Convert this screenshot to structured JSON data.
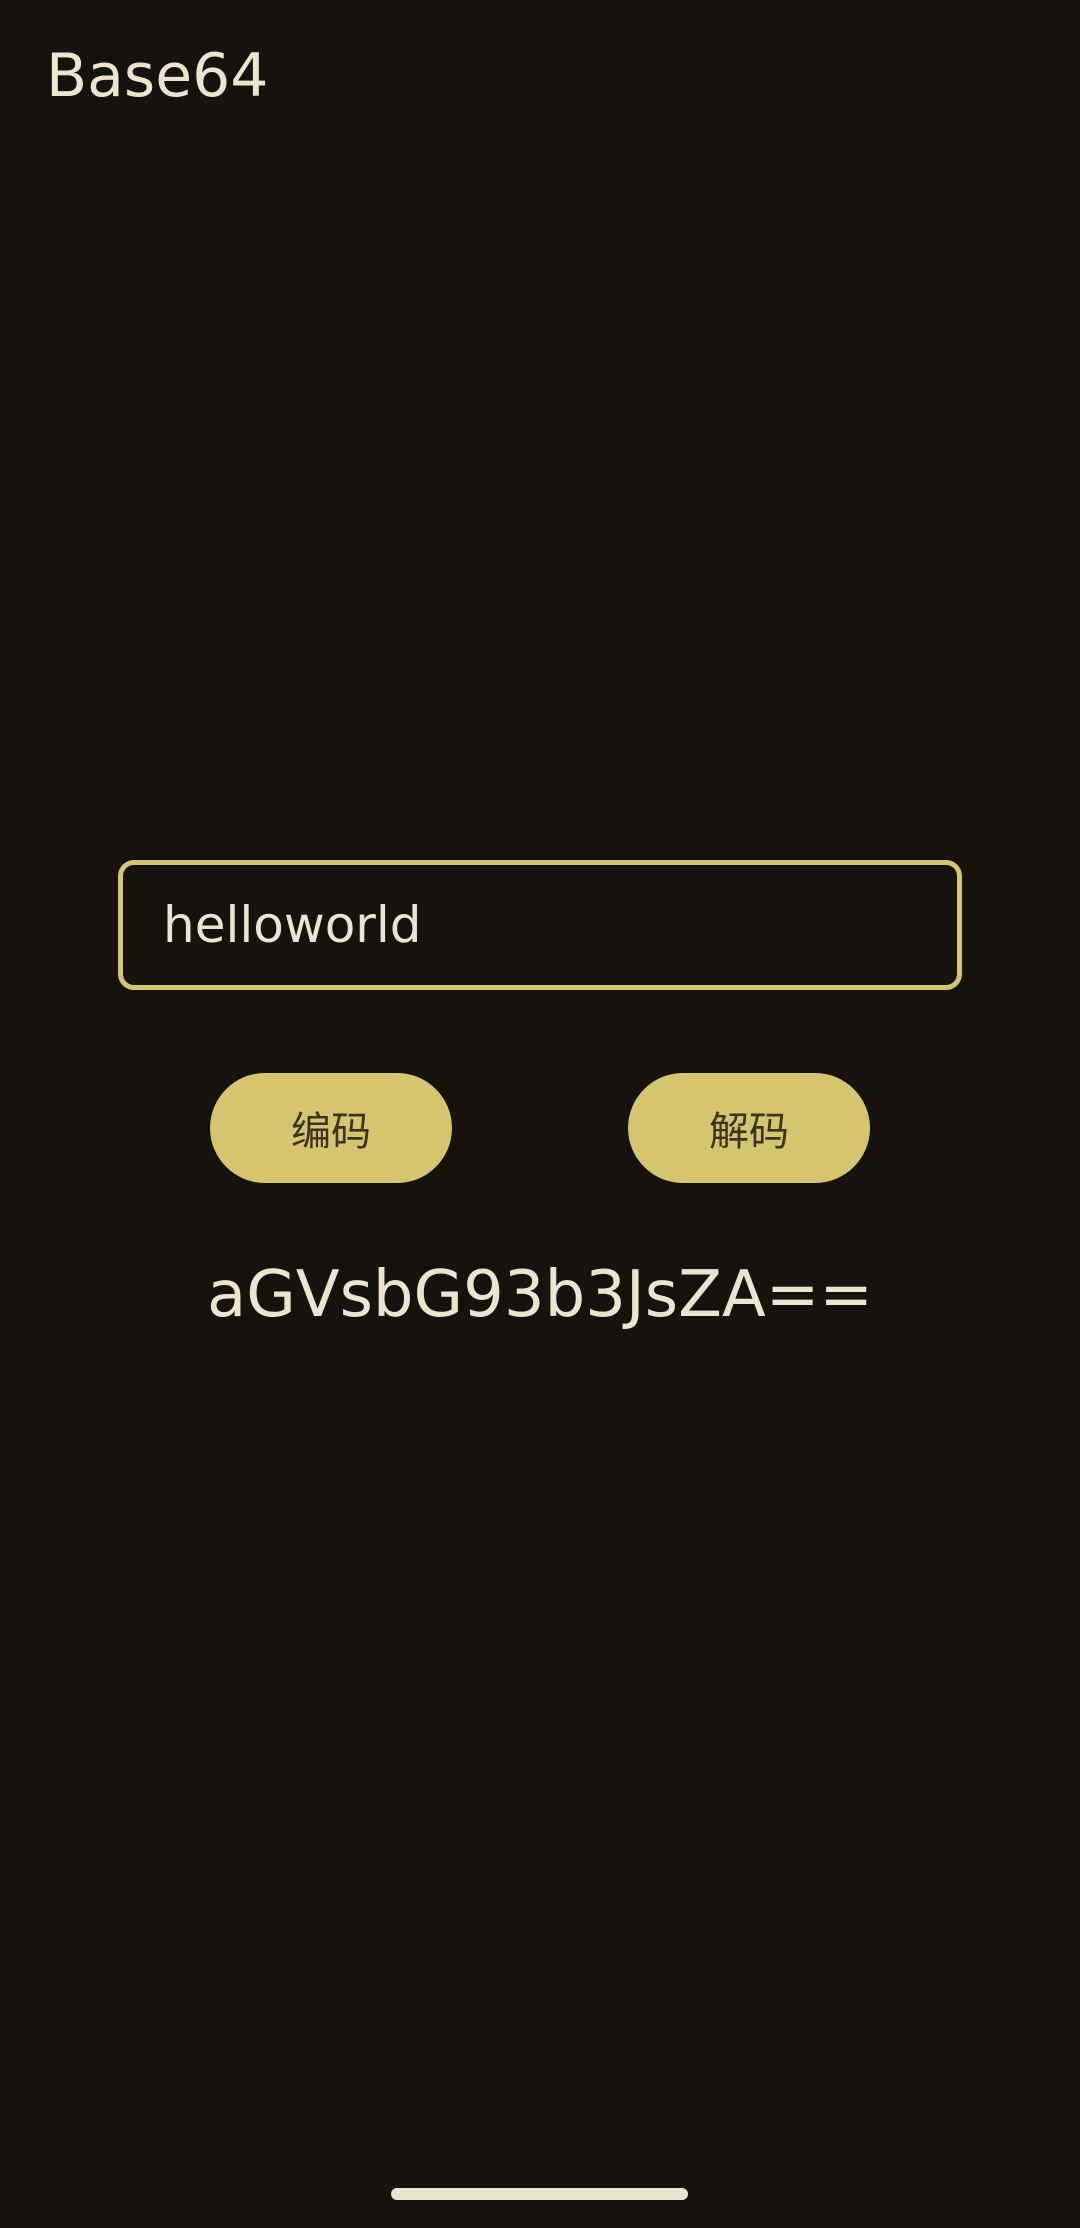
{
  "app": {
    "title": "Base64"
  },
  "input": {
    "value": "helloworld"
  },
  "buttons": {
    "encode_label": "编码",
    "decode_label": "解码"
  },
  "output": {
    "text": "aGVsbG93b3JsZA=="
  },
  "colors": {
    "background": "#16130e",
    "accent": "#d6c56f",
    "text": "#ece4cf",
    "button_text": "#3b3520"
  }
}
